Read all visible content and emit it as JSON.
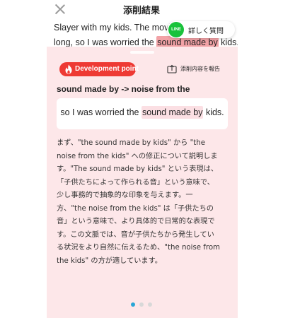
{
  "header": {
    "title": "添削結果",
    "close_icon": "close-icon"
  },
  "essay": {
    "line1": "Slayer with my kids. The movie",
    "line2_before": "long, so I was worried the ",
    "line2_highlight": "sound made by",
    "line2_after": " kids.",
    "highlight_color": "#f2a2a6"
  },
  "line_button": {
    "icon_text": "LINE",
    "label": "詳しく質問",
    "icon_color": "#19c23b"
  },
  "panel": {
    "background": "#fde7e9",
    "badge": {
      "icon": "flame-icon",
      "label": "Development point",
      "color": "#ee3a34"
    },
    "report": {
      "icon": "report-icon",
      "label": "添削内容を報告"
    },
    "correction": "sound made by -> noise from the",
    "example": {
      "before": "so I was worried the ",
      "highlight": "sound made by",
      "after": " kids."
    },
    "explanation": [
      "まず、\"the sound made by kids\" から \"the",
      "noise from the kids\" への修正について説明しま",
      "す。\"The sound made by kids\" という表現は、",
      "「子供たちによって作られる音」という意味で、",
      "少し事務的で抽象的な印象を与えます。一",
      "方、\"the noise from the kids\" は「子供たちの",
      "音」という意味で、より具体的で日常的な表現で",
      "す。この文脈では、音が子供たちから発生してい",
      "る状況をより自然に伝えるため、\"the noise from",
      "the kids\" の方が適しています。"
    ],
    "pagination": {
      "total": 3,
      "active": 1,
      "active_color": "#2aa6d6"
    }
  }
}
